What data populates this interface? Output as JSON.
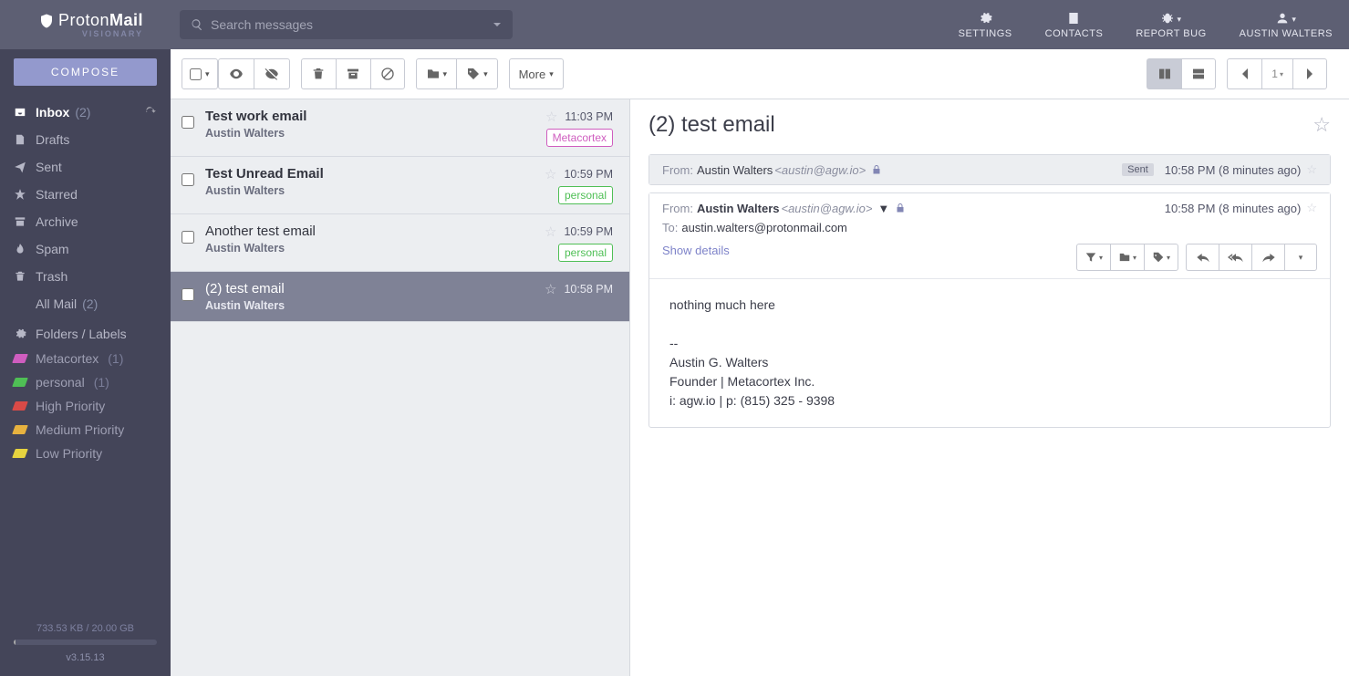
{
  "brand": {
    "name_a": "Proton",
    "name_b": "Mail",
    "tier": "VISIONARY"
  },
  "search": {
    "placeholder": "Search messages"
  },
  "header_actions": {
    "settings": "SETTINGS",
    "contacts": "CONTACTS",
    "report_bug": "REPORT BUG",
    "account": "AUSTIN WALTERS"
  },
  "compose_label": "COMPOSE",
  "folders": {
    "inbox": {
      "label": "Inbox",
      "count": "(2)"
    },
    "drafts": {
      "label": "Drafts"
    },
    "sent": {
      "label": "Sent"
    },
    "starred": {
      "label": "Starred"
    },
    "archive": {
      "label": "Archive"
    },
    "spam": {
      "label": "Spam"
    },
    "trash": {
      "label": "Trash"
    },
    "allmail": {
      "label": "All Mail",
      "count": "(2)"
    }
  },
  "labels_section": "Folders / Labels",
  "labels": [
    {
      "name": "Metacortex",
      "count": "(1)",
      "color": "#cf5dbf"
    },
    {
      "name": "personal",
      "count": "(1)",
      "color": "#4fbf55"
    },
    {
      "name": "High Priority",
      "count": "",
      "color": "#d94a47"
    },
    {
      "name": "Medium Priority",
      "count": "",
      "color": "#e7b23f"
    },
    {
      "name": "Low Priority",
      "count": "",
      "color": "#e7d33f"
    }
  ],
  "storage": {
    "used": "733.53 KB",
    "sep": " / ",
    "total": "20.00 GB"
  },
  "version": "v3.15.13",
  "toolbar": {
    "more": "More",
    "page": "1"
  },
  "messages": [
    {
      "subject": "Test work email",
      "sender": "Austin Walters",
      "time": "11:03 PM",
      "unread": true,
      "tags": [
        {
          "text": "Metacortex",
          "color": "#cf5dbf"
        }
      ],
      "selected": false
    },
    {
      "subject": "Test Unread Email",
      "sender": "Austin Walters",
      "time": "10:59 PM",
      "unread": true,
      "tags": [
        {
          "text": "personal",
          "color": "#4fbf55"
        }
      ],
      "selected": false
    },
    {
      "subject": "Another test email",
      "sender": "Austin Walters",
      "time": "10:59 PM",
      "unread": false,
      "tags": [
        {
          "text": "personal",
          "color": "#4fbf55"
        }
      ],
      "selected": false
    },
    {
      "subject": "(2) test email",
      "sender": "Austin Walters",
      "time": "10:58 PM",
      "unread": false,
      "tags": [],
      "selected": true
    }
  ],
  "reader": {
    "subject": "(2) test email",
    "collapsed": {
      "from_label": "From:",
      "from_name": "Austin Walters",
      "from_addr": "<austin@agw.io>",
      "sent_badge": "Sent",
      "time": "10:58 PM (8 minutes ago)"
    },
    "expanded": {
      "from_label": "From:",
      "from_name": "Austin Walters",
      "from_addr": "<austin@agw.io>",
      "time": "10:58 PM (8 minutes ago)",
      "to_label": "To:",
      "to_addr": "austin.walters@protonmail.com",
      "show_details": "Show details",
      "body": "nothing much here\n\n--\nAustin G. Walters\nFounder | Metacortex Inc.\ni: agw.io | p: (815) 325 - 9398"
    }
  }
}
